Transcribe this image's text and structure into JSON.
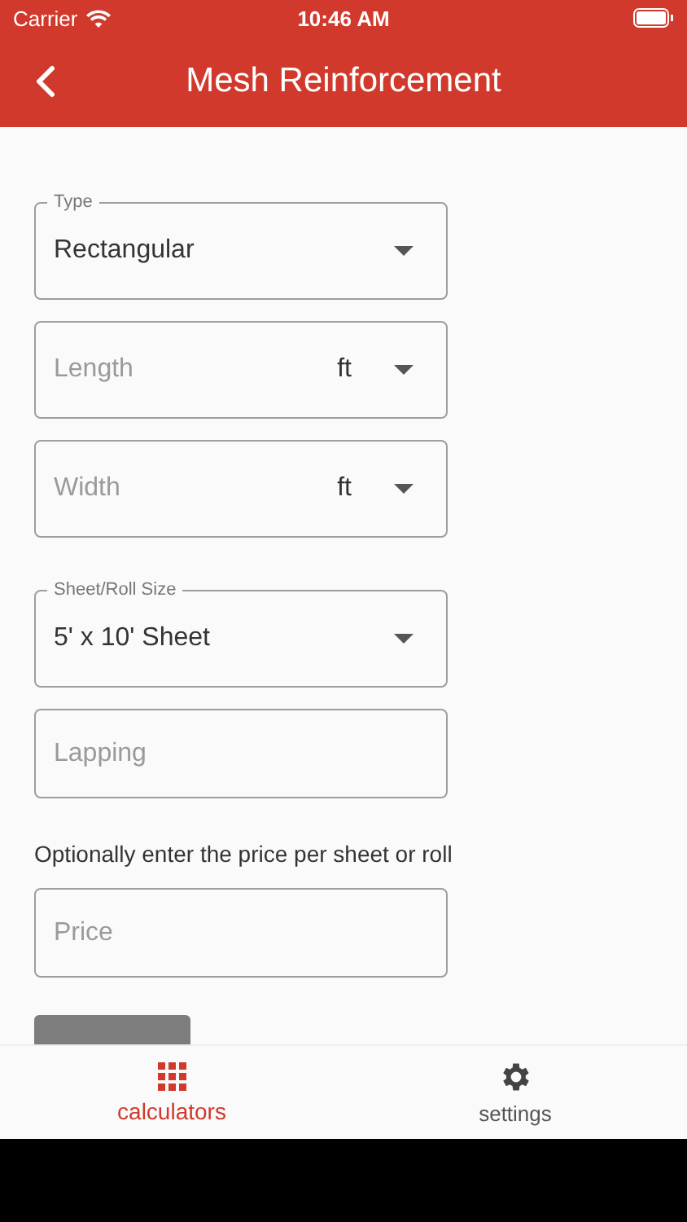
{
  "status_bar": {
    "carrier": "Carrier",
    "time": "10:46 AM"
  },
  "header": {
    "title": "Mesh Reinforcement"
  },
  "fields": [
    {
      "kind": "select",
      "label": "Type",
      "value": "Rectangular"
    },
    {
      "kind": "unit_input",
      "placeholder": "Length",
      "unit": "ft"
    },
    {
      "kind": "unit_input",
      "placeholder": "Width",
      "unit": "ft"
    },
    {
      "kind": "select",
      "label": "Sheet/Roll Size",
      "value": "5' x 10' Sheet"
    },
    {
      "kind": "input",
      "placeholder": "Lapping"
    },
    {
      "kind": "note",
      "text": "Optionally enter the price per sheet or roll"
    },
    {
      "kind": "input",
      "placeholder": "Price"
    }
  ],
  "tabs": [
    {
      "label": "calculators",
      "selected": true
    },
    {
      "label": "settings",
      "selected": false
    }
  ]
}
